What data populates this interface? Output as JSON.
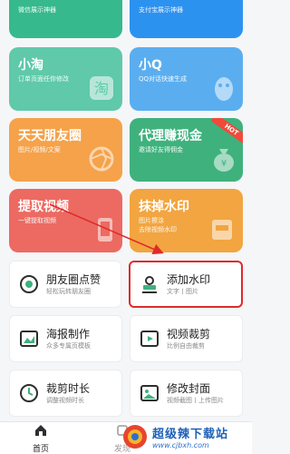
{
  "top": {
    "left_sub": "微信展示神器",
    "right_sub": "支付宝展示神器"
  },
  "cards": {
    "xiaotao": {
      "title": "小淘",
      "sub": "订单页面任你修改"
    },
    "xiaoq": {
      "title": "小Q",
      "sub": "QQ对话快速生成"
    },
    "moments": {
      "title": "天天朋友圈",
      "sub": "图片/视频/文案"
    },
    "agent": {
      "title": "代理赚现金",
      "sub": "邀请好友得佣金",
      "badge": "HOT"
    },
    "extract": {
      "title": "提取视频",
      "sub": "一键提取视频"
    },
    "remove": {
      "title": "抹掉水印",
      "sub1": "图片擦涂",
      "sub2": "去除视频水印"
    }
  },
  "tools": [
    {
      "title": "朋友圈点赞",
      "sub": "轻松玩转朋友圈"
    },
    {
      "title": "添加水印",
      "sub": "文字丨图片"
    },
    {
      "title": "海报制作",
      "sub": "众多专属页模板"
    },
    {
      "title": "视频裁剪",
      "sub": "比例自由裁剪"
    },
    {
      "title": "裁剪时长",
      "sub": "调整视频时长"
    },
    {
      "title": "修改封面",
      "sub": "视频截图丨上传图片"
    }
  ],
  "nav": {
    "home": "首页",
    "discover": "发现"
  },
  "watermark": {
    "title": "超级辣下载站",
    "url": "www.cjbxh.com"
  },
  "colors": {
    "highlight": "#e02a2a",
    "watermark_blue": "#1d5fb8"
  }
}
